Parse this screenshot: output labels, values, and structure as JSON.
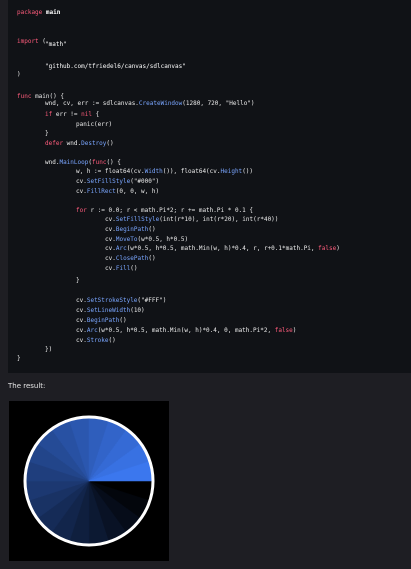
{
  "code": {
    "lines": [
      {
        "indent": 0,
        "tokens": [
          {
            "t": "package",
            "c": "kw"
          },
          {
            "t": " main",
            "c": "bold"
          }
        ]
      },
      {
        "indent": 0,
        "tokens": []
      },
      {
        "indent": 0,
        "tokens": [
          {
            "t": "import",
            "c": "kw"
          },
          {
            "t": " (",
            "c": "plain"
          }
        ]
      },
      {
        "indent": 1,
        "tokens": [
          {
            "t": "\"math\"",
            "c": "str"
          }
        ]
      },
      {
        "indent": 0,
        "tokens": []
      },
      {
        "indent": 1,
        "tokens": [
          {
            "t": "\"github.com/tfriedel6/canvas/sdlcanvas\"",
            "c": "str"
          }
        ]
      },
      {
        "indent": 0,
        "tokens": [
          {
            "t": ")",
            "c": "plain"
          }
        ]
      },
      {
        "indent": 0,
        "tokens": []
      },
      {
        "indent": 0,
        "tokens": [
          {
            "t": "func",
            "c": "kw"
          },
          {
            "t": " main() {",
            "c": "plain"
          }
        ]
      },
      {
        "indent": 1,
        "tokens": [
          {
            "t": "wnd, cv, err := sdlcanvas.",
            "c": "plain"
          },
          {
            "t": "CreateWindow",
            "c": "fn"
          },
          {
            "t": "(1280, 720, \"Hello\")",
            "c": "plain"
          }
        ]
      },
      {
        "indent": 1,
        "tokens": [
          {
            "t": "if",
            "c": "kw"
          },
          {
            "t": " err != ",
            "c": "plain"
          },
          {
            "t": "nil",
            "c": "kw"
          },
          {
            "t": " {",
            "c": "plain"
          }
        ]
      },
      {
        "indent": 2,
        "tokens": [
          {
            "t": "panic(err)",
            "c": "plain"
          }
        ]
      },
      {
        "indent": 1,
        "tokens": [
          {
            "t": "}",
            "c": "plain"
          }
        ]
      },
      {
        "indent": 1,
        "tokens": [
          {
            "t": "defer",
            "c": "kw"
          },
          {
            "t": " wnd.",
            "c": "plain"
          },
          {
            "t": "Destroy",
            "c": "fn"
          },
          {
            "t": "()",
            "c": "plain"
          }
        ]
      },
      {
        "indent": 0,
        "tokens": []
      },
      {
        "indent": 1,
        "tokens": [
          {
            "t": "wnd.",
            "c": "plain"
          },
          {
            "t": "MainLoop",
            "c": "fn"
          },
          {
            "t": "(",
            "c": "plain"
          },
          {
            "t": "func",
            "c": "kw"
          },
          {
            "t": "() {",
            "c": "plain"
          }
        ]
      },
      {
        "indent": 2,
        "tokens": [
          {
            "t": "w, h := float64(cv.",
            "c": "plain"
          },
          {
            "t": "Width",
            "c": "fn"
          },
          {
            "t": "()), float64(cv.",
            "c": "plain"
          },
          {
            "t": "Height",
            "c": "fn"
          },
          {
            "t": "())",
            "c": "plain"
          }
        ]
      },
      {
        "indent": 2,
        "tokens": [
          {
            "t": "cv.",
            "c": "plain"
          },
          {
            "t": "SetFillStyle",
            "c": "fn"
          },
          {
            "t": "(\"#000\")",
            "c": "plain"
          }
        ]
      },
      {
        "indent": 2,
        "tokens": [
          {
            "t": "cv.",
            "c": "plain"
          },
          {
            "t": "FillRect",
            "c": "fn"
          },
          {
            "t": "(0, 0, w, h)",
            "c": "plain"
          }
        ]
      },
      {
        "indent": 0,
        "tokens": []
      },
      {
        "indent": 2,
        "tokens": [
          {
            "t": "for",
            "c": "kw"
          },
          {
            "t": " r := 0.0; r < math.Pi*2; r += math.Pi * 0.1 {",
            "c": "plain"
          }
        ]
      },
      {
        "indent": 3,
        "tokens": [
          {
            "t": "cv.",
            "c": "plain"
          },
          {
            "t": "SetFillStyle",
            "c": "fn"
          },
          {
            "t": "(int(r*10), int(r*20), int(r*40))",
            "c": "plain"
          }
        ]
      },
      {
        "indent": 3,
        "tokens": [
          {
            "t": "cv.",
            "c": "plain"
          },
          {
            "t": "BeginPath",
            "c": "fn"
          },
          {
            "t": "()",
            "c": "plain"
          }
        ]
      },
      {
        "indent": 3,
        "tokens": [
          {
            "t": "cv.",
            "c": "plain"
          },
          {
            "t": "MoveTo",
            "c": "fn"
          },
          {
            "t": "(w*0.5, h*0.5)",
            "c": "plain"
          }
        ]
      },
      {
        "indent": 3,
        "tokens": [
          {
            "t": "cv.",
            "c": "plain"
          },
          {
            "t": "Arc",
            "c": "fn"
          },
          {
            "t": "(w*0.5, h*0.5, math.Min(w, h)*0.4, r, r+0.1*math.Pi, ",
            "c": "plain"
          },
          {
            "t": "false",
            "c": "kw"
          },
          {
            "t": ")",
            "c": "plain"
          }
        ]
      },
      {
        "indent": 3,
        "tokens": [
          {
            "t": "cv.",
            "c": "plain"
          },
          {
            "t": "ClosePath",
            "c": "fn"
          },
          {
            "t": "()",
            "c": "plain"
          }
        ]
      },
      {
        "indent": 3,
        "tokens": [
          {
            "t": "cv.",
            "c": "plain"
          },
          {
            "t": "Fill",
            "c": "fn"
          },
          {
            "t": "()",
            "c": "plain"
          }
        ]
      },
      {
        "indent": 2,
        "tokens": [
          {
            "t": "}",
            "c": "plain"
          }
        ]
      },
      {
        "indent": 0,
        "tokens": []
      },
      {
        "indent": 2,
        "tokens": [
          {
            "t": "cv.",
            "c": "plain"
          },
          {
            "t": "SetStrokeStyle",
            "c": "fn"
          },
          {
            "t": "(\"#FFF\")",
            "c": "plain"
          }
        ]
      },
      {
        "indent": 2,
        "tokens": [
          {
            "t": "cv.",
            "c": "plain"
          },
          {
            "t": "SetLineWidth",
            "c": "fn"
          },
          {
            "t": "(10)",
            "c": "plain"
          }
        ]
      },
      {
        "indent": 2,
        "tokens": [
          {
            "t": "cv.",
            "c": "plain"
          },
          {
            "t": "BeginPath",
            "c": "fn"
          },
          {
            "t": "()",
            "c": "plain"
          }
        ]
      },
      {
        "indent": 2,
        "tokens": [
          {
            "t": "cv.",
            "c": "plain"
          },
          {
            "t": "Arc",
            "c": "fn"
          },
          {
            "t": "(w*0.5, h*0.5, math.Min(w, h)*0.4, 0, math.Pi*2, ",
            "c": "plain"
          },
          {
            "t": "false",
            "c": "kw"
          },
          {
            "t": ")",
            "c": "plain"
          }
        ]
      },
      {
        "indent": 2,
        "tokens": [
          {
            "t": "cv.",
            "c": "plain"
          },
          {
            "t": "Stroke",
            "c": "fn"
          },
          {
            "t": "()",
            "c": "plain"
          }
        ]
      },
      {
        "indent": 1,
        "tokens": [
          {
            "t": "})",
            "c": "plain"
          }
        ]
      },
      {
        "indent": 0,
        "tokens": [
          {
            "t": "}",
            "c": "plain"
          }
        ]
      }
    ]
  },
  "result_label": "The result:",
  "result_canvas": {
    "background": "#000000",
    "stroke_color": "#ffffff",
    "wedge_count": 20
  }
}
